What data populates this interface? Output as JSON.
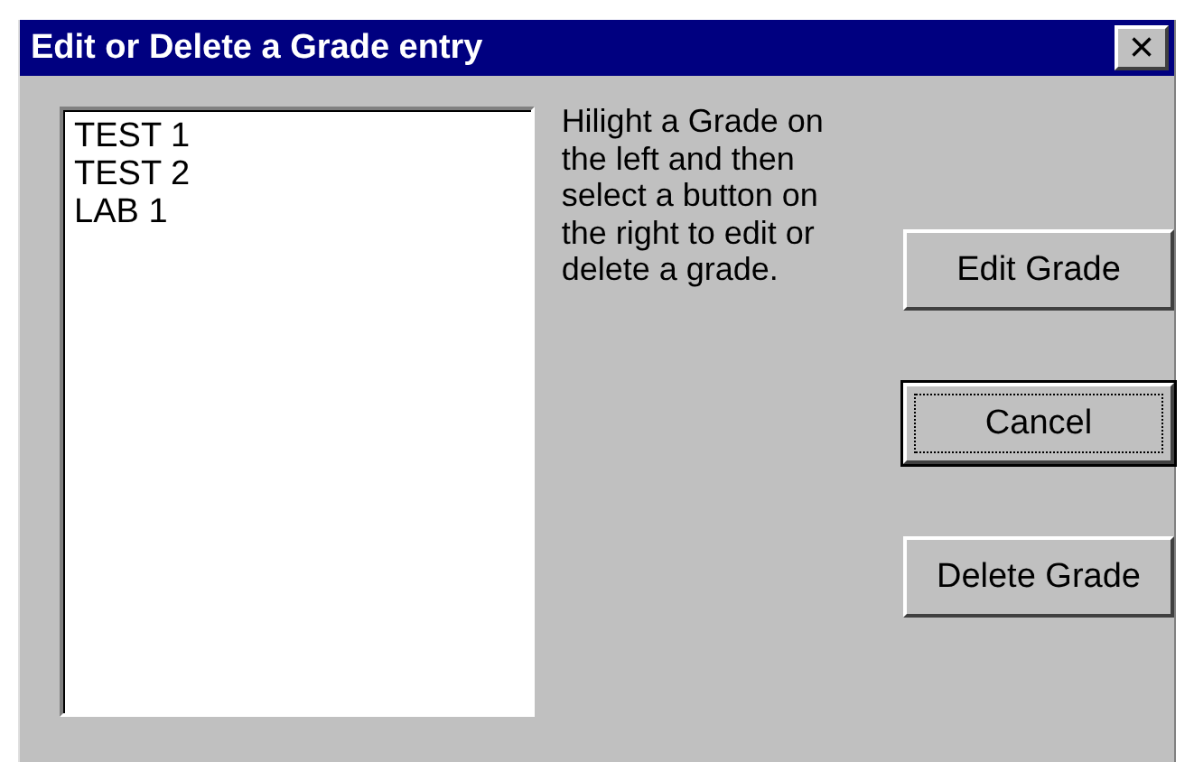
{
  "window": {
    "title": "Edit or Delete a Grade entry",
    "close": "×"
  },
  "grade_list": {
    "items": [
      {
        "label": "TEST 1",
        "selected": false
      },
      {
        "label": "TEST 2",
        "selected": false
      },
      {
        "label": "LAB 1",
        "selected": false
      }
    ]
  },
  "instructions": "Hilight a Grade on the left and then select a button on the right to edit or delete a grade.",
  "buttons": [
    {
      "label": "Edit Grade",
      "focused": false
    },
    {
      "label": "Cancel",
      "focused": true
    },
    {
      "label": "Delete Grade",
      "focused": false
    }
  ]
}
